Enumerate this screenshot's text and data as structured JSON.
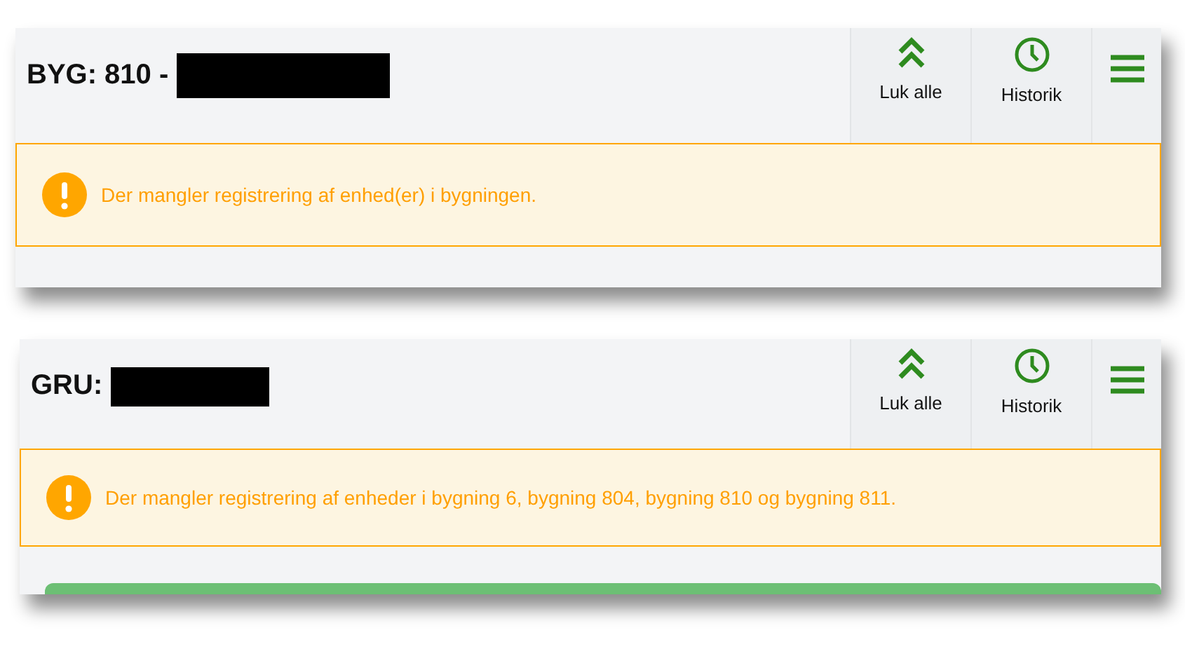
{
  "panels": [
    {
      "title": "BYG: 810 -",
      "redacted": true,
      "actions": [
        {
          "kind": "collapse",
          "label": "Luk alle"
        },
        {
          "kind": "history",
          "label": "Historik"
        },
        {
          "kind": "menu"
        }
      ],
      "alert": {
        "kind": "warning",
        "text": "Der mangler registrering af enhed(er) i bygningen."
      }
    },
    {
      "title": "GRU:",
      "redacted": true,
      "actions": [
        {
          "kind": "collapse",
          "label": "Luk alle"
        },
        {
          "kind": "history",
          "label": "Historik"
        },
        {
          "kind": "menu"
        }
      ],
      "alert": {
        "kind": "warning",
        "text": "Der mangler registrering af enheder i bygning 6, bygning 804, bygning 810 og bygning 811."
      },
      "next_section": true
    }
  ]
}
